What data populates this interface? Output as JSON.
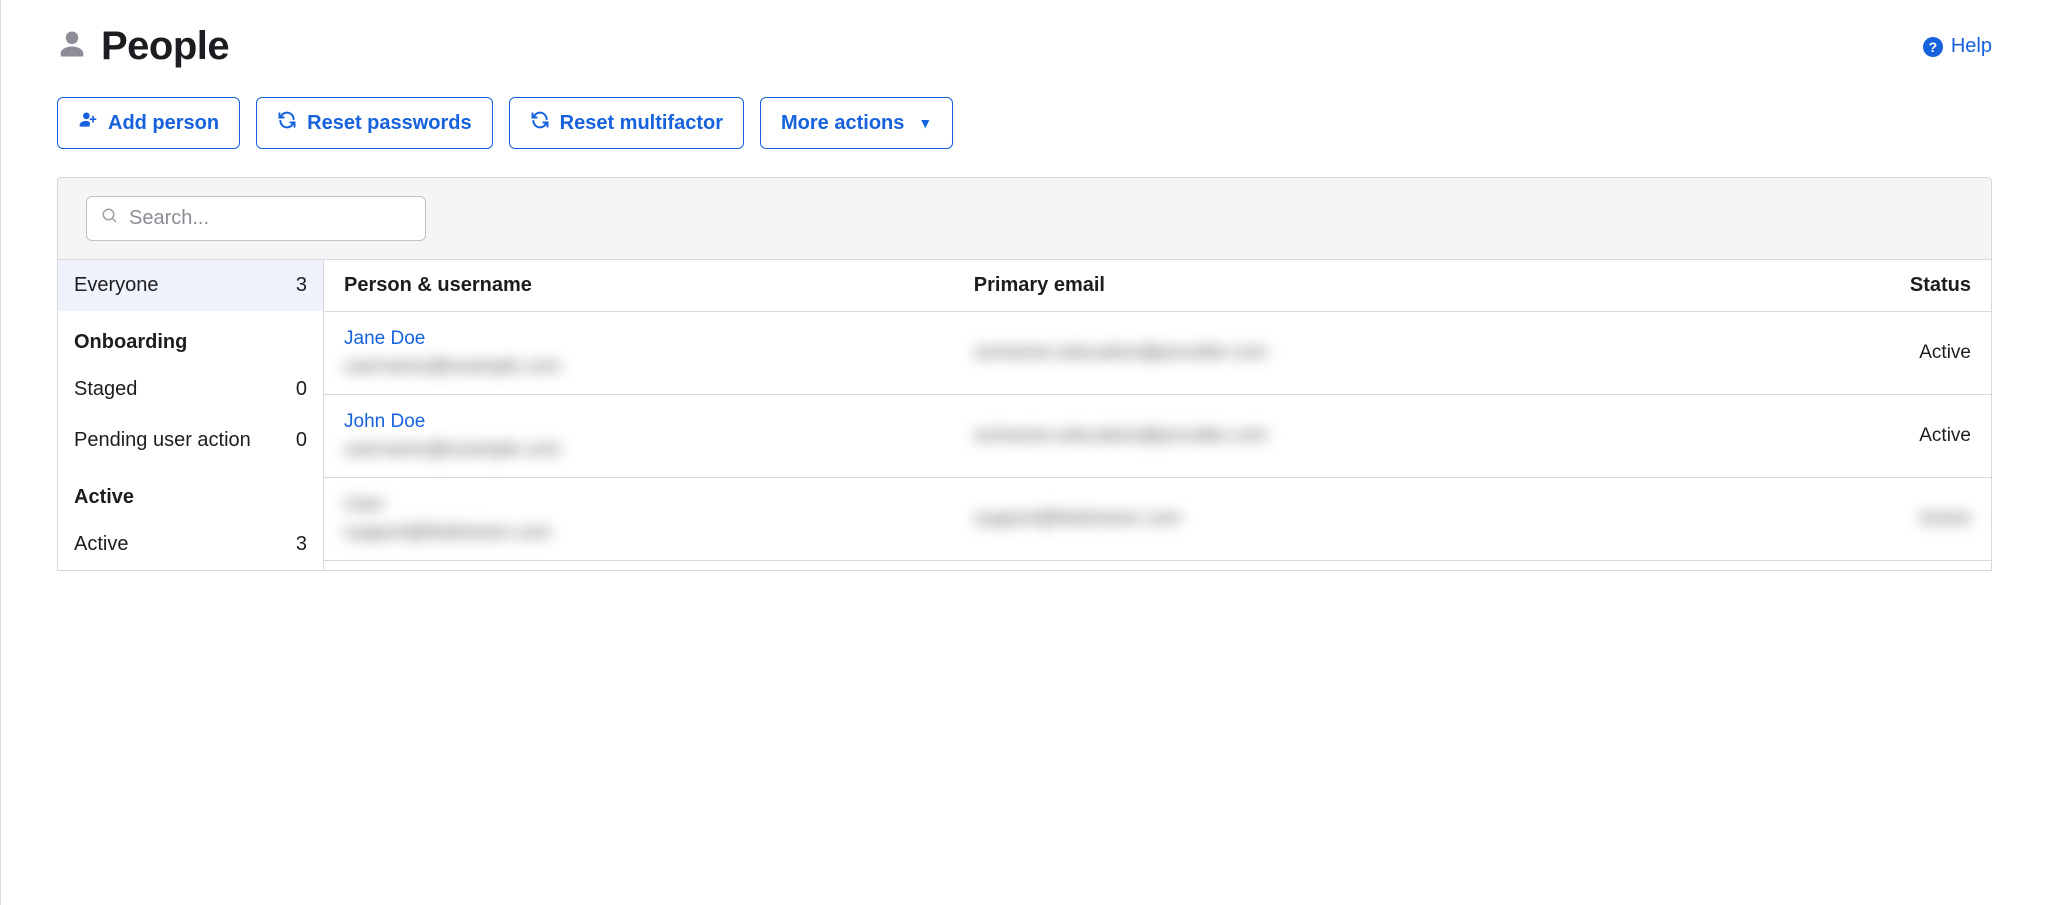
{
  "page": {
    "title": "People"
  },
  "help": {
    "label": "Help",
    "glyph": "?"
  },
  "toolbar": {
    "add_person": "Add person",
    "reset_passwords": "Reset passwords",
    "reset_multifactor": "Reset multifactor",
    "more_actions": "More actions"
  },
  "search": {
    "placeholder": "Search..."
  },
  "sidebar": {
    "everyone": {
      "label": "Everyone",
      "count": "3"
    },
    "onboarding_heading": "Onboarding",
    "staged": {
      "label": "Staged",
      "count": "0"
    },
    "pending": {
      "label": "Pending user action",
      "count": "0"
    },
    "active_heading": "Active",
    "active": {
      "label": "Active",
      "count": "3"
    }
  },
  "table": {
    "headers": {
      "person": "Person & username",
      "email": "Primary email",
      "status": "Status"
    },
    "rows": [
      {
        "name": "Jane Doe",
        "username_masked": "username@example.com",
        "email_masked": "someone.education@provider.com",
        "status": "Active"
      },
      {
        "name": "John Doe",
        "username_masked": "username@example.com",
        "email_masked": "someone.education@provider.com",
        "status": "Active"
      },
      {
        "name": "User",
        "username_masked": "support@fieldvision.com",
        "email_masked": "support@fieldvision.com",
        "status": "Active",
        "all_blurred": true
      }
    ]
  }
}
